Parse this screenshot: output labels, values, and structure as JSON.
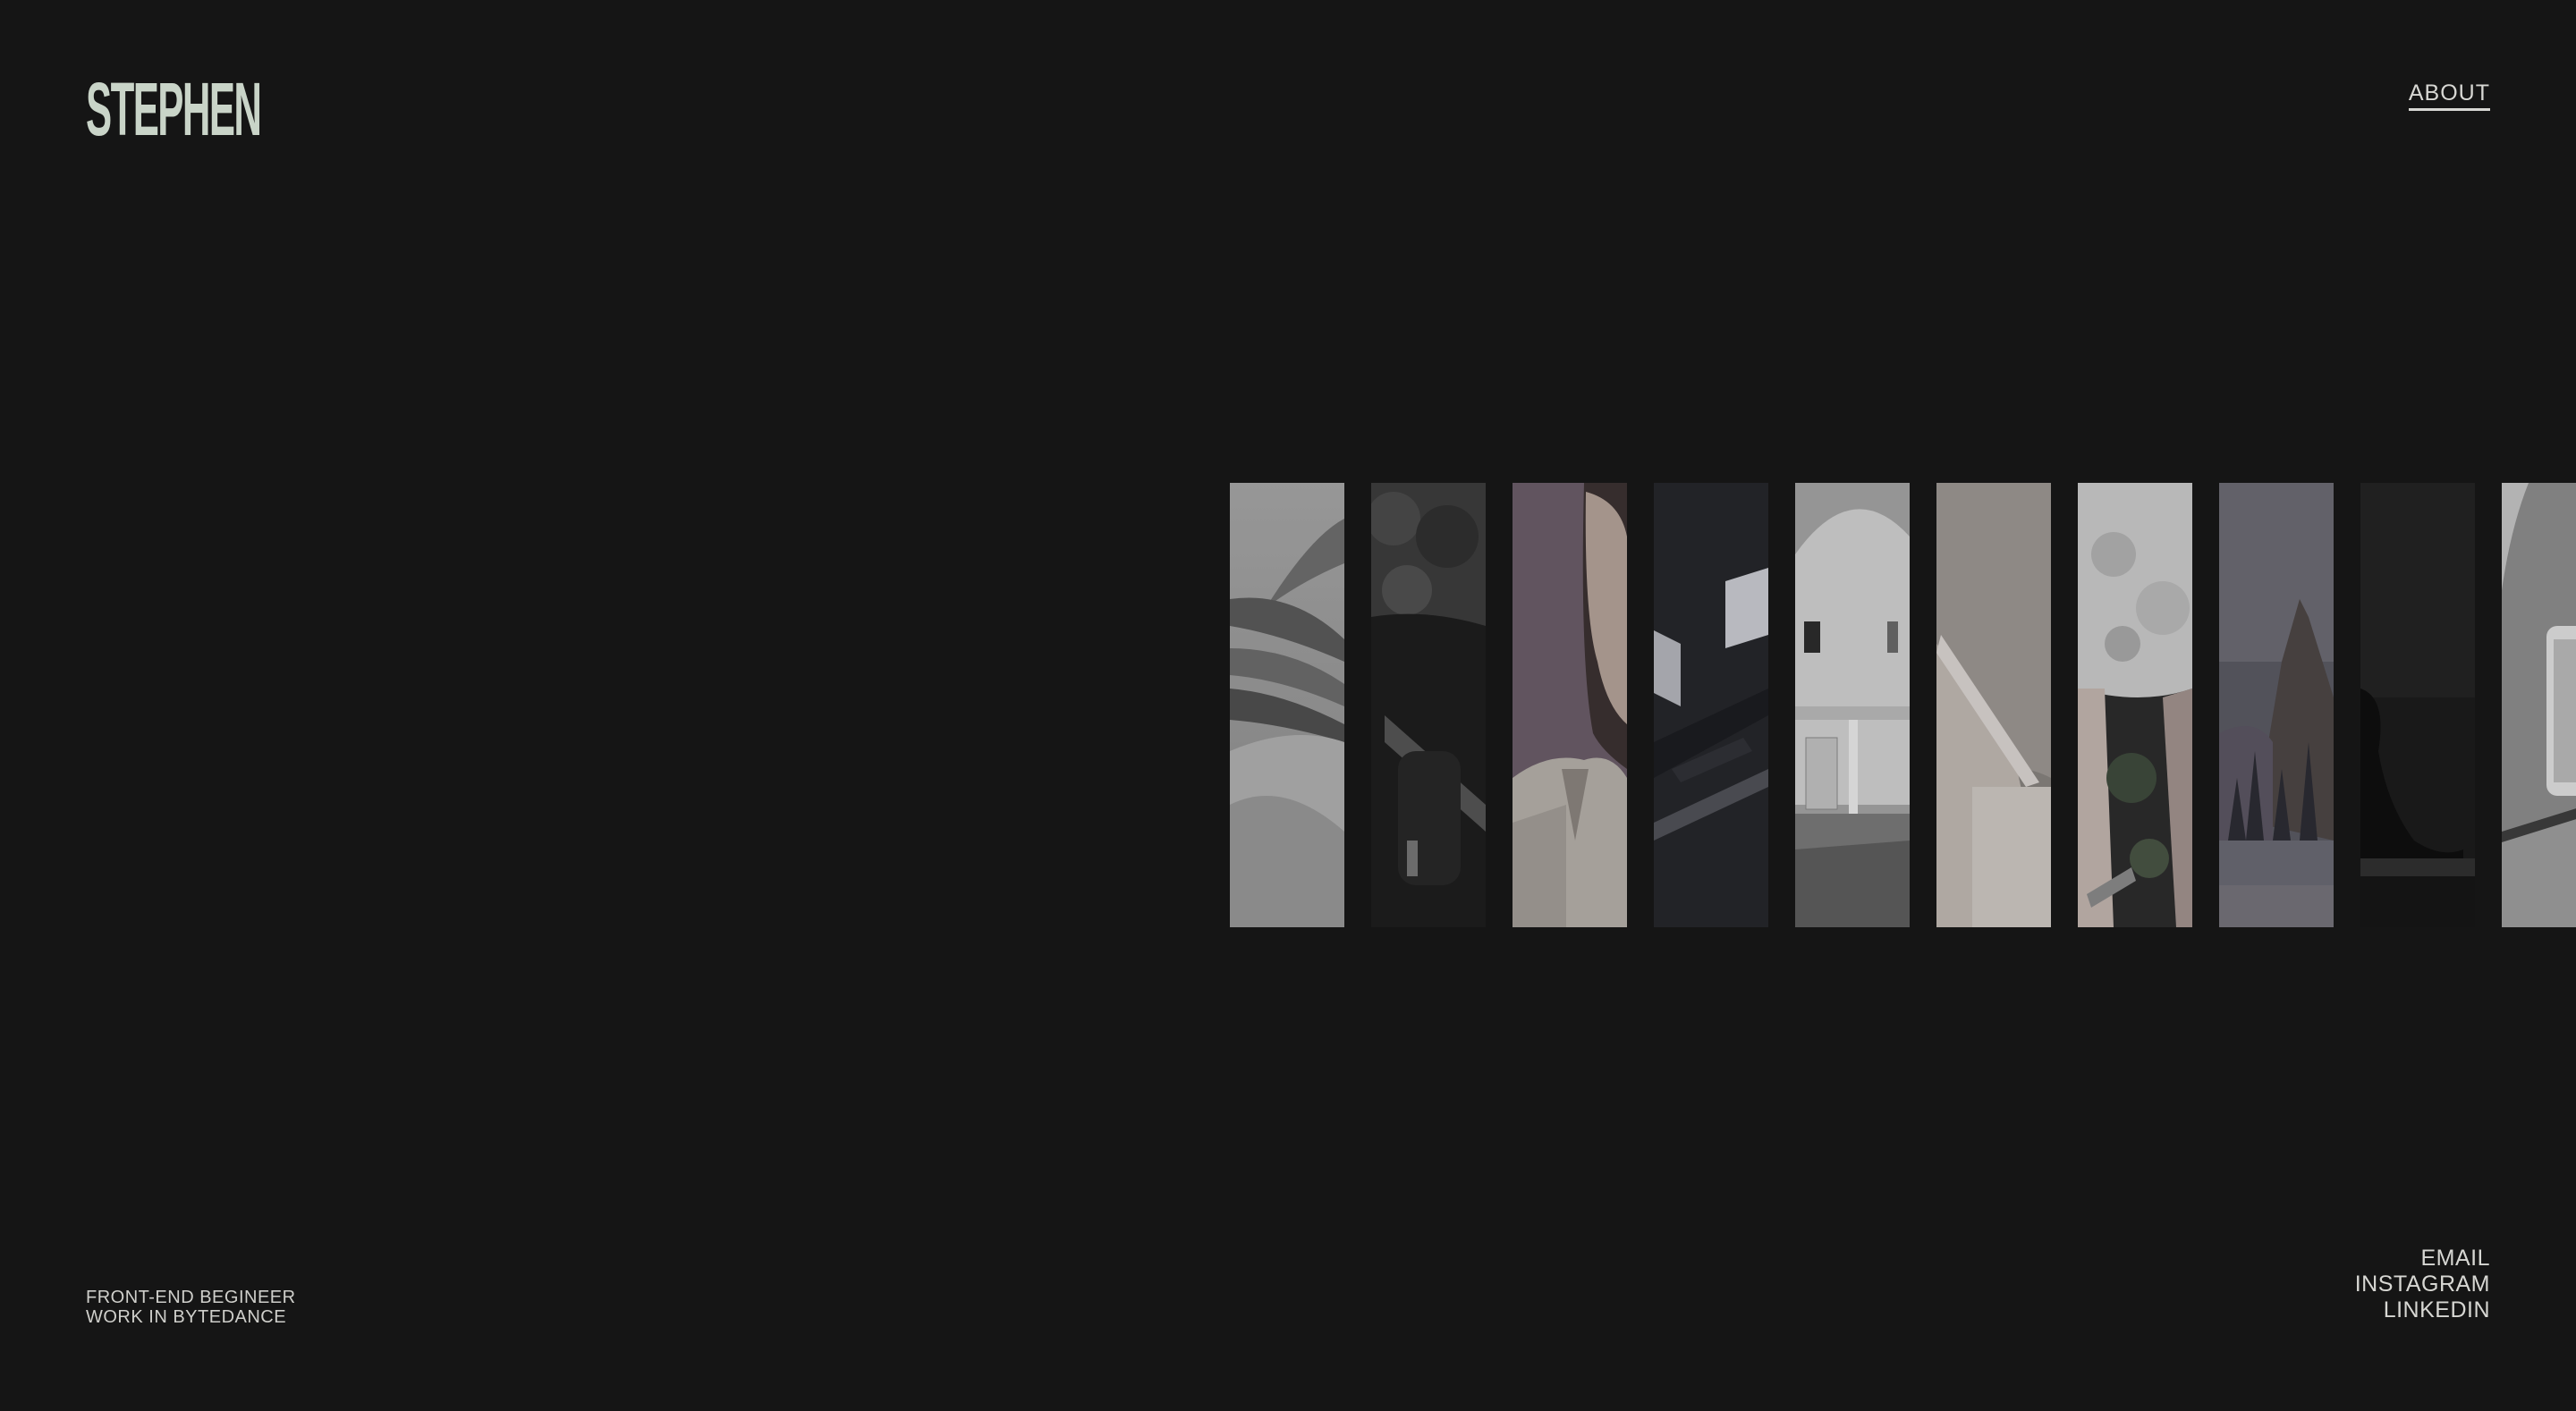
{
  "header": {
    "logo": "STEPHEN",
    "about_label": "ABOUT"
  },
  "gallery": {
    "strip_count": 10
  },
  "footer": {
    "tagline_line1": "FRONT-END BEGINEER",
    "tagline_line2": "WORK IN BYTEDANCE",
    "social": {
      "email_label": "EMAIL",
      "instagram_label": "INSTAGRAM",
      "linkedin_label": "LINKEDIN"
    }
  },
  "colors": {
    "background": "#151515",
    "logo": "#c9d4c8",
    "text": "#d7d7d3"
  }
}
